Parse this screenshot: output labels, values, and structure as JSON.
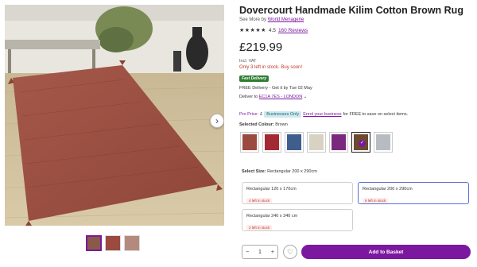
{
  "gallery": {
    "next_icon": "chevron-right-icon",
    "thumbnails": [
      {
        "color": "#8a5a48",
        "active": true
      },
      {
        "color": "#9a4a3e",
        "active": false
      },
      {
        "color": "#b48a7e",
        "active": false
      }
    ]
  },
  "product": {
    "title": "Dovercourt Handmade Kilim Cotton Brown Rug",
    "see_more_prefix": "See More by",
    "brand": "World Menagerie",
    "rating_stars": "★★★★★",
    "rating_value": "4.5",
    "reviews": "160 Reviews",
    "price": "£219.99",
    "vat_note": "Incl. VAT",
    "stock_note": "Only 3 left in stock. Buy soon!",
    "fast_delivery": "Fast Delivery",
    "delivery_text": "FREE Delivery - Get it by Tue 02 May",
    "deliver_to_label": "Deliver to",
    "postcode": "EC1A 7ES - LONDON",
    "chevron": "⌄"
  },
  "pro_pricing": {
    "label": "Pro Price:",
    "currency_prefix": "£",
    "badge": "Businesses Only",
    "enroll_link": "Enrol your business",
    "suffix": "for FREE to save on select items."
  },
  "color_selector": {
    "label": "Selected Colour:",
    "value": "Brown",
    "swatches": [
      {
        "name": "brown-red",
        "color": "#9a4a3e",
        "selected": false
      },
      {
        "name": "red",
        "color": "#a32a34",
        "selected": false
      },
      {
        "name": "blue",
        "color": "#3e5e8e",
        "selected": false
      },
      {
        "name": "cream",
        "color": "#d8d2c2",
        "selected": false
      },
      {
        "name": "purple",
        "color": "#7a2a7e",
        "selected": false
      },
      {
        "name": "brown",
        "color": "#6b4a2e",
        "selected": true
      },
      {
        "name": "grey",
        "color": "#b8bcc2",
        "selected": false
      }
    ]
  },
  "size_selector": {
    "label": "Select Size:",
    "value": "Rectangular 200 x 290cm",
    "options": [
      {
        "name": "Rectangular 120 x 170cm",
        "stock": "4 left in stock",
        "selected": false
      },
      {
        "name": "Rectangular 200 x 290cm",
        "stock": "6 left in stock",
        "selected": true
      },
      {
        "name": "Rectangular 240 x 340 cm",
        "stock": "2 left in stock",
        "selected": false
      }
    ]
  },
  "purchase": {
    "minus": "−",
    "quantity": "1",
    "plus": "+",
    "wishlist_icon": "heart-icon",
    "add_to_basket": "Add to Basket"
  },
  "colors": {
    "accent": "#7b189f",
    "stock_red": "#c0392b",
    "fast_green": "#2e7d32",
    "selected_border": "#5b6fd8"
  }
}
